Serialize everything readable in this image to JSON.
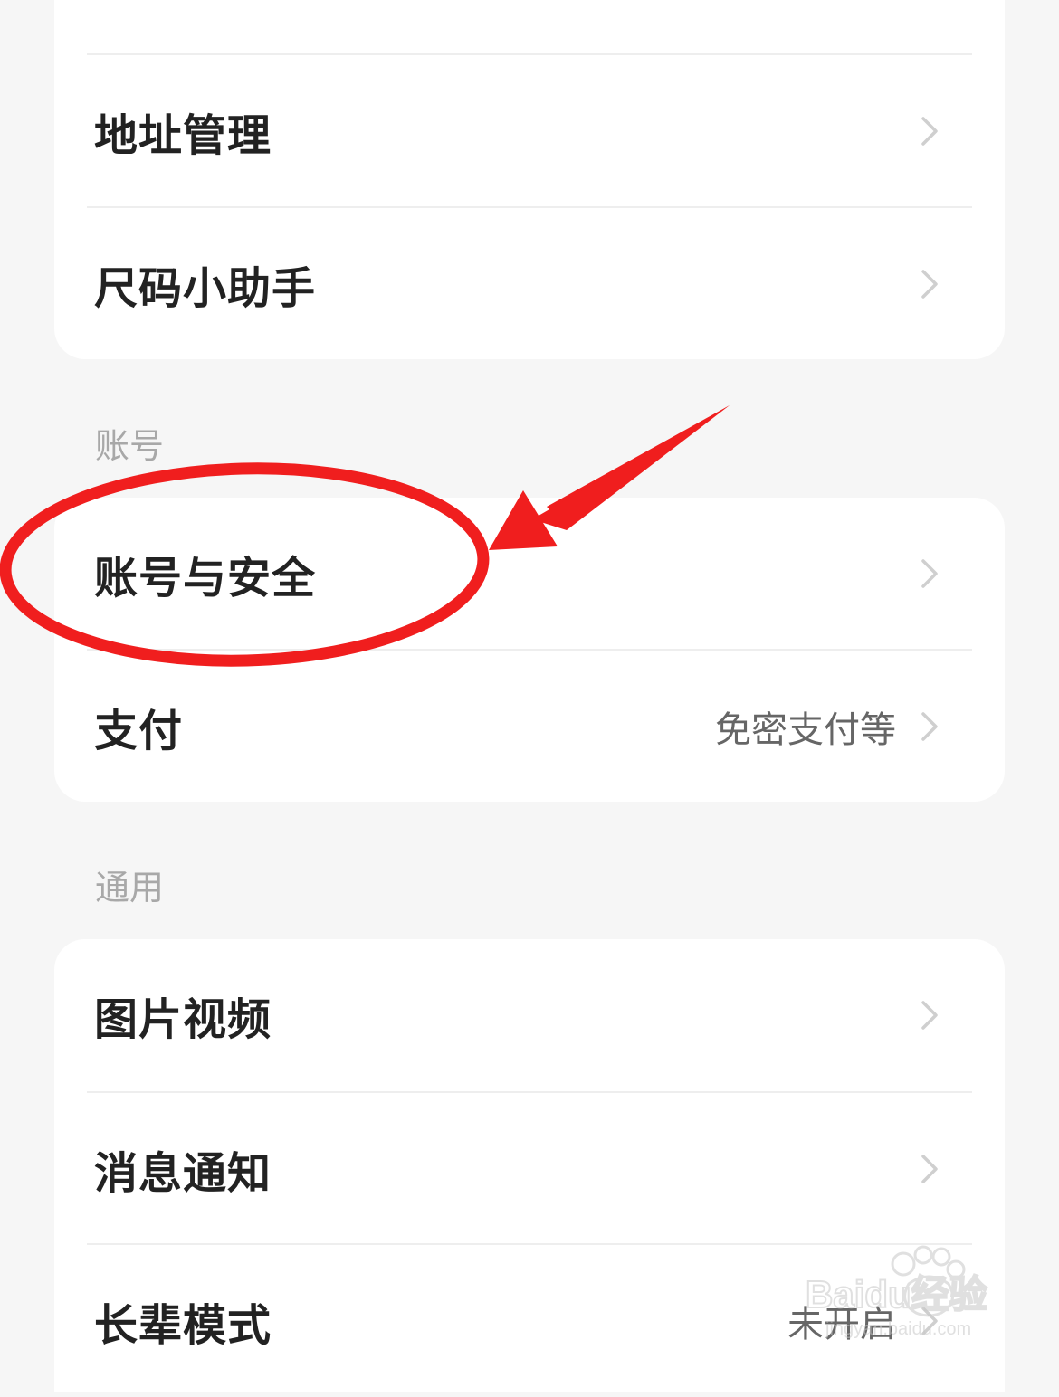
{
  "sections": {
    "top": {
      "items": [
        {
          "label": "地址管理"
        },
        {
          "label": "尺码小助手"
        }
      ]
    },
    "account": {
      "title": "账号",
      "items": [
        {
          "label": "账号与安全"
        },
        {
          "label": "支付",
          "value": "免密支付等"
        }
      ]
    },
    "general": {
      "title": "通用",
      "items": [
        {
          "label": "图片视频"
        },
        {
          "label": "消息通知"
        },
        {
          "label": "长辈模式",
          "value": "未开启"
        }
      ]
    }
  },
  "annotation": {
    "color": "#f01e1e"
  },
  "watermark": {
    "brand": "Baidu经验",
    "url": "jingyan.baidu.com"
  }
}
